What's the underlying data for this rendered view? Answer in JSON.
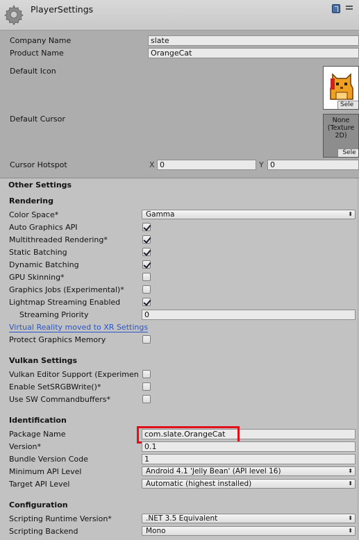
{
  "header": {
    "title": "PlayerSettings"
  },
  "general": {
    "company_label": "Company Name",
    "company_value": "slate",
    "product_label": "Product Name",
    "product_value": "OrangeCat",
    "icon_label": "Default Icon",
    "icon_select": "Sele",
    "cursor_label": "Default Cursor",
    "cursor_none_line1": "None",
    "cursor_none_line2": "(Texture",
    "cursor_none_line3": "2D)",
    "cursor_select": "Sele",
    "hotspot_label": "Cursor Hotspot",
    "hotspot_x_label": "X",
    "hotspot_x_value": "0",
    "hotspot_y_label": "Y",
    "hotspot_y_value": "0"
  },
  "other_settings": {
    "title": "Other Settings",
    "rendering": {
      "title": "Rendering",
      "color_space_label": "Color Space*",
      "color_space_value": "Gamma",
      "auto_graphics_label": "Auto Graphics API",
      "auto_graphics": true,
      "multithreaded_label": "Multithreaded Rendering*",
      "multithreaded": true,
      "static_batching_label": "Static Batching",
      "static_batching": true,
      "dynamic_batching_label": "Dynamic Batching",
      "dynamic_batching": true,
      "gpu_skinning_label": "GPU Skinning*",
      "gpu_skinning": false,
      "graphics_jobs_label": "Graphics Jobs (Experimental)*",
      "graphics_jobs": false,
      "lightmap_streaming_label": "Lightmap Streaming Enabled",
      "lightmap_streaming": true,
      "streaming_priority_label": "Streaming Priority",
      "streaming_priority_value": "0",
      "vr_link": "Virtual Reality moved to XR Settings",
      "protect_memory_label": "Protect Graphics Memory",
      "protect_memory": false
    },
    "vulkan": {
      "title": "Vulkan Settings",
      "editor_support_label": "Vulkan Editor Support (Experimen",
      "editor_support": false,
      "srgb_write_label": "Enable SetSRGBWrite()*",
      "srgb_write": false,
      "sw_cmdbuffers_label": "Use SW Commandbuffers*",
      "sw_cmdbuffers": false
    },
    "identification": {
      "title": "Identification",
      "package_label": "Package Name",
      "package_value": "com.slate.OrangeCat",
      "version_label": "Version*",
      "version_value": "0.1",
      "bundle_code_label": "Bundle Version Code",
      "bundle_code_value": "1",
      "min_api_label": "Minimum API Level",
      "min_api_value": "Android 4.1 'Jelly Bean' (API level 16)",
      "target_api_label": "Target API Level",
      "target_api_value": "Automatic (highest installed)"
    },
    "configuration": {
      "title": "Configuration",
      "runtime_label": "Scripting Runtime Version*",
      "runtime_value": ".NET 3.5 Equivalent",
      "backend_label": "Scripting Backend",
      "backend_value": "Mono"
    }
  },
  "icons": {
    "gear": "gear-icon",
    "help": "help-icon",
    "menu": "settings-menu-icon",
    "dropdown": "chevron-updown-icon",
    "check": "checkmark-icon"
  },
  "colors": {
    "highlight": "#e0101a",
    "link": "#2a55c6",
    "background": "#c2c2c2",
    "top_panel": "#adadad"
  }
}
